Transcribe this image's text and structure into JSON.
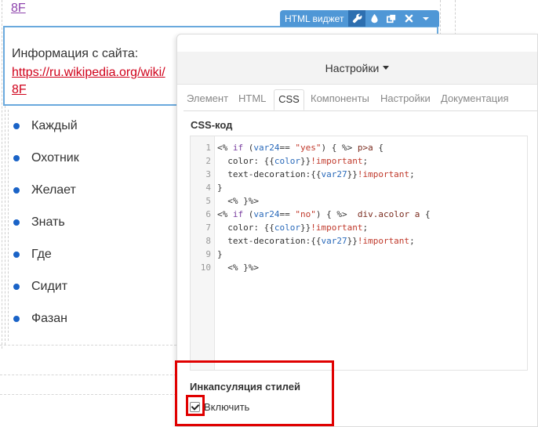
{
  "page": {
    "top_link": "8F",
    "info_label": "Информация с сайта:",
    "info_link_line1": "https://ru.wikipedia.org/wiki/",
    "info_link_line2": "8F",
    "bullets": [
      "Каждый",
      "Охотник",
      "Желает",
      "Знать",
      "Где",
      "Сидит",
      "Фазан"
    ]
  },
  "toolbar": {
    "title": "HTML виджет",
    "icons": [
      "wrench-icon",
      "drop-icon",
      "copy-icon",
      "close-icon",
      "caret-down-icon"
    ]
  },
  "panel": {
    "header": "Настройки",
    "tabs": [
      "Элемент",
      "HTML",
      "CSS",
      "Компоненты",
      "Настройки",
      "Документация"
    ],
    "active_tab": "CSS",
    "css_title": "CSS-код",
    "code_lines": [
      "<% if (var24== \"yes\") { %> p>a {",
      "  color: {{color}}!important;",
      "  text-decoration:{{var27}}!important;",
      "}",
      "  <% }%>",
      "<% if (var24== \"no\") { %>  div.acolor a {",
      "  color: {{color}}!important;",
      "  text-decoration:{{var27}}!important;",
      "}",
      "  <% }%>"
    ],
    "encapsulation_title": "Инкапсуляция стилей",
    "enable_label": "Включить",
    "enable_checked": true
  },
  "colors": {
    "toolbar_blue": "#4f97d6",
    "highlight_red": "#e00000",
    "link_red": "#d0021b",
    "bullet_blue": "#1a63c7"
  }
}
